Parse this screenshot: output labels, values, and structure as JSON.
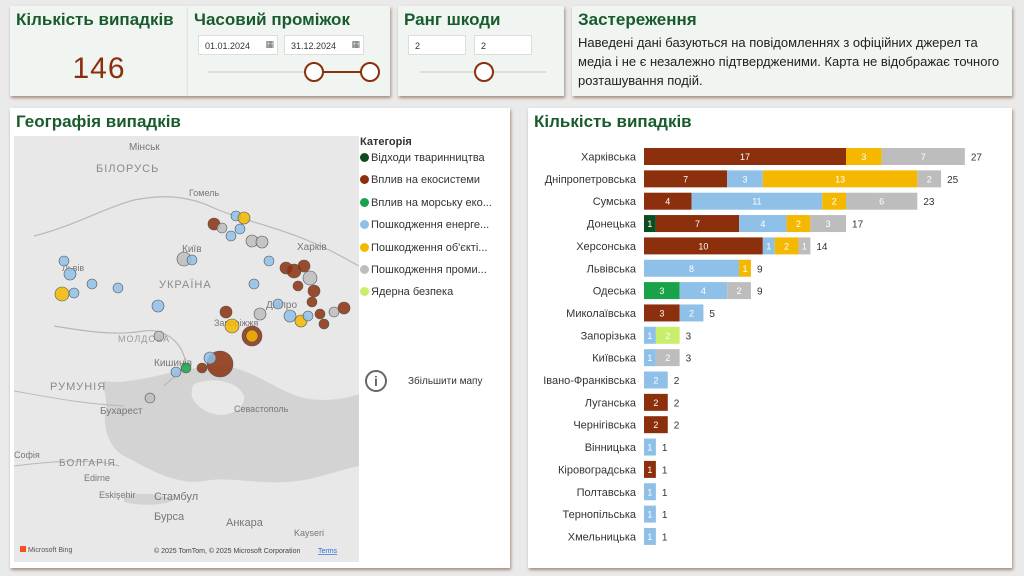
{
  "kpi": {
    "title": "Кількість випадків",
    "value": "146"
  },
  "time_slicer": {
    "title": "Часовий проміжок",
    "start": "01.01.2024",
    "end": "31.12.2024"
  },
  "damage_slicer": {
    "title": "Ранг шкоди",
    "min": "2",
    "max": "2"
  },
  "disclaimer": {
    "title": "Застереження",
    "text": "Наведені дані базуються на повідомленнях з офіційних джерел та медіа і не є незалежно підтвердженими. Карта не відображає точного розташування подій."
  },
  "map": {
    "title": "Географія випадків",
    "legend_title": "Категорія",
    "legend": [
      {
        "label": "Відходи тваринництва",
        "color": "#0b4d1f"
      },
      {
        "label": "Вплив на екосистеми",
        "color": "#8b2f0d"
      },
      {
        "label": "Вплив на морську еко...",
        "color": "#18a34a"
      },
      {
        "label": "Пошкодження енерге...",
        "color": "#8fc0e8"
      },
      {
        "label": "Пошкодження об'єкті...",
        "color": "#f5b800"
      },
      {
        "label": "Пошкодження проми...",
        "color": "#bdbdbd"
      },
      {
        "label": "Ядерна безпека",
        "color": "#c8ee6a"
      }
    ],
    "zoom_label": "Збільшити мапу",
    "labels": {
      "minsk": "Мінськ",
      "belarus": "БІЛОРУСЬ",
      "homel": "Гомель",
      "kyiv": "Київ",
      "kharkiv": "Харків",
      "lviv": "Львів",
      "ukraine": "УКРАЇНА",
      "dnipro": "Дніпро",
      "zaporizhzhia": "Запоріжжя",
      "moldova": "МОЛДОВА",
      "chisinau": "Кишинів",
      "romania": "РУМУНІЯ",
      "bucharest": "Бухарест",
      "sevastopol": "Севастополь",
      "sofia": "Софія",
      "bulgaria": "БОЛГАРІЯ",
      "edirne": "Edirne",
      "eskisehir": "Eskişehir",
      "istanbul": "Стамбул",
      "bursa": "Бурса",
      "ankara": "Анкара",
      "kayseri": "Kayseri"
    },
    "attribution": "© 2025 TomTom, © 2025 Microsoft Corporation",
    "terms": "Terms",
    "bing": "Microsoft Bing"
  },
  "chart_data": {
    "type": "bar",
    "stacked": true,
    "orientation": "horizontal",
    "title": "Кількість випадків",
    "series_colors": {
      "Відходи тваринництва": "#0b4d1f",
      "Вплив на екосистеми": "#8b2f0d",
      "Вплив на морську екосистему": "#18a34a",
      "Пошкодження енергетики": "#8fc0e8",
      "Пошкодження об'єктів": "#f5b800",
      "Пошкодження промисловості": "#bdbdbd",
      "Ядерна безпека": "#c8ee6a"
    },
    "rows": [
      {
        "category": "Харківська",
        "segments": [
          [
            "Вплив на екосистеми",
            17
          ],
          [
            "Пошкодження об'єктів",
            3
          ],
          [
            "Пошкодження промисловості",
            7
          ]
        ],
        "total": 27
      },
      {
        "category": "Дніпропетровська",
        "segments": [
          [
            "Вплив на екосистеми",
            7
          ],
          [
            "Пошкодження енергетики",
            3
          ],
          [
            "Пошкодження об'єктів",
            13
          ],
          [
            "Пошкодження промисловості",
            2
          ]
        ],
        "total": 25
      },
      {
        "category": "Сумська",
        "segments": [
          [
            "Вплив на екосистеми",
            4
          ],
          [
            "Пошкодження енергетики",
            11
          ],
          [
            "Пошкодження об'єктів",
            2
          ],
          [
            "Пошкодження промисловості",
            6
          ]
        ],
        "total": 23
      },
      {
        "category": "Донецька",
        "segments": [
          [
            "Відходи тваринництва",
            1
          ],
          [
            "Вплив на екосистеми",
            7
          ],
          [
            "Пошкодження енергетики",
            4
          ],
          [
            "Пошкодження об'єктів",
            2
          ],
          [
            "Пошкодження промисловості",
            3
          ]
        ],
        "total": 17
      },
      {
        "category": "Херсонська",
        "segments": [
          [
            "Вплив на екосистеми",
            10
          ],
          [
            "Пошкодження енергетики",
            1
          ],
          [
            "Пошкодження об'єктів",
            2
          ],
          [
            "Пошкодження промисловості",
            1
          ]
        ],
        "total": 14
      },
      {
        "category": "Львівська",
        "segments": [
          [
            "Пошкодження енергетики",
            8
          ],
          [
            "Пошкодження об'єктів",
            1
          ]
        ],
        "total": 9
      },
      {
        "category": "Одеська",
        "segments": [
          [
            "Вплив на морську екосистему",
            3
          ],
          [
            "Пошкодження енергетики",
            4
          ],
          [
            "Пошкодження промисловості",
            2
          ]
        ],
        "total": 9
      },
      {
        "category": "Миколаївська",
        "segments": [
          [
            "Вплив на екосистеми",
            3
          ],
          [
            "Пошкодження енергетики",
            2
          ]
        ],
        "total": 5
      },
      {
        "category": "Запорізька",
        "segments": [
          [
            "Пошкодження енергетики",
            1
          ],
          [
            "Ядерна безпека",
            2
          ]
        ],
        "total": 3
      },
      {
        "category": "Київська",
        "segments": [
          [
            "Пошкодження енергетики",
            1
          ],
          [
            "Пошкодження промисловості",
            2
          ]
        ],
        "total": 3
      },
      {
        "category": "Івано-Франківська",
        "segments": [
          [
            "Пошкодження енергетики",
            2
          ]
        ],
        "total": 2
      },
      {
        "category": "Луганська",
        "segments": [
          [
            "Вплив на екосистеми",
            2
          ]
        ],
        "total": 2
      },
      {
        "category": "Чернігівська",
        "segments": [
          [
            "Вплив на екосистеми",
            2
          ]
        ],
        "total": 2
      },
      {
        "category": "Вінницька",
        "segments": [
          [
            "Пошкодження енергетики",
            1
          ]
        ],
        "total": 1
      },
      {
        "category": "Кіровоградська",
        "segments": [
          [
            "Вплив на екосистеми",
            1
          ]
        ],
        "total": 1
      },
      {
        "category": "Полтавська",
        "segments": [
          [
            "Пошкодження енергетики",
            1
          ]
        ],
        "total": 1
      },
      {
        "category": "Тернопільська",
        "segments": [
          [
            "Пошкодження енергетики",
            1
          ]
        ],
        "total": 1
      },
      {
        "category": "Хмельницька",
        "segments": [
          [
            "Пошкодження енергетики",
            1
          ]
        ],
        "total": 1
      }
    ],
    "xlim": [
      0,
      27
    ]
  }
}
